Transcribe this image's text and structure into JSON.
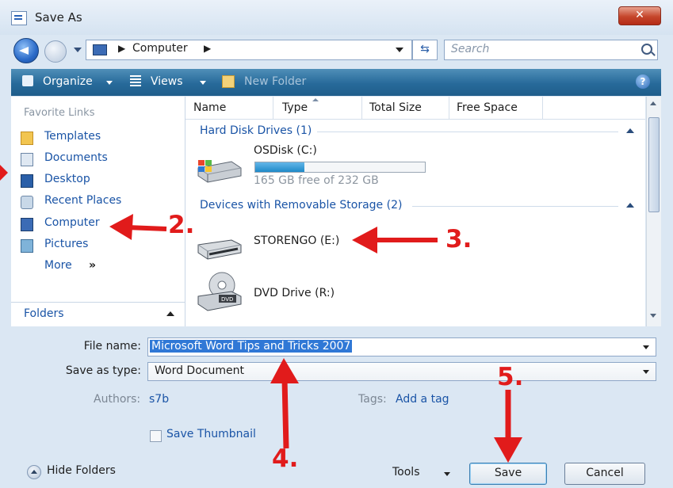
{
  "window": {
    "title": "Save As"
  },
  "address": {
    "location": "Computer",
    "search_placeholder": "Search"
  },
  "toolbar": {
    "organize": "Organize",
    "views": "Views",
    "new_folder": "New Folder"
  },
  "nav": {
    "header": "Favorite Links",
    "items": [
      {
        "label": "Templates",
        "icon": "templates-folder-icon"
      },
      {
        "label": "Documents",
        "icon": "documents-icon"
      },
      {
        "label": "Desktop",
        "icon": "desktop-icon"
      },
      {
        "label": "Recent Places",
        "icon": "recent-places-icon"
      },
      {
        "label": "Computer",
        "icon": "computer-icon"
      },
      {
        "label": "Pictures",
        "icon": "pictures-icon"
      }
    ],
    "more": "More",
    "folders": "Folders"
  },
  "columns": [
    "Name",
    "Type",
    "Total Size",
    "Free Space"
  ],
  "groups": {
    "hard_disks": {
      "title": "Hard Disk Drives (1)",
      "drives": [
        {
          "name": "OSDisk (C:)",
          "free": "165 GB free of 232 GB",
          "used_fraction": 0.29
        }
      ]
    },
    "removable": {
      "title": "Devices with Removable Storage (2)",
      "drives": [
        {
          "name": "STORENGO (E:)"
        },
        {
          "name": "DVD Drive (R:)"
        }
      ]
    }
  },
  "form": {
    "file_name_label": "File name:",
    "file_name_value": "Microsoft Word Tips and Tricks 2007",
    "save_type_label": "Save as type:",
    "save_type_value": "Word Document",
    "authors_label": "Authors:",
    "authors_value": "s7b",
    "tags_label": "Tags:",
    "tags_value": "Add a tag",
    "thumbnail_label": "Save Thumbnail"
  },
  "footer": {
    "hide_folders": "Hide Folders",
    "tools": "Tools",
    "save": "Save",
    "cancel": "Cancel"
  },
  "annotations": [
    "2.",
    "3.",
    "4.",
    "5."
  ],
  "colors": {
    "annotation": "#e11b1b",
    "toolbar": "#276a9a",
    "link": "#1a54a6",
    "selection": "#3078d6"
  }
}
